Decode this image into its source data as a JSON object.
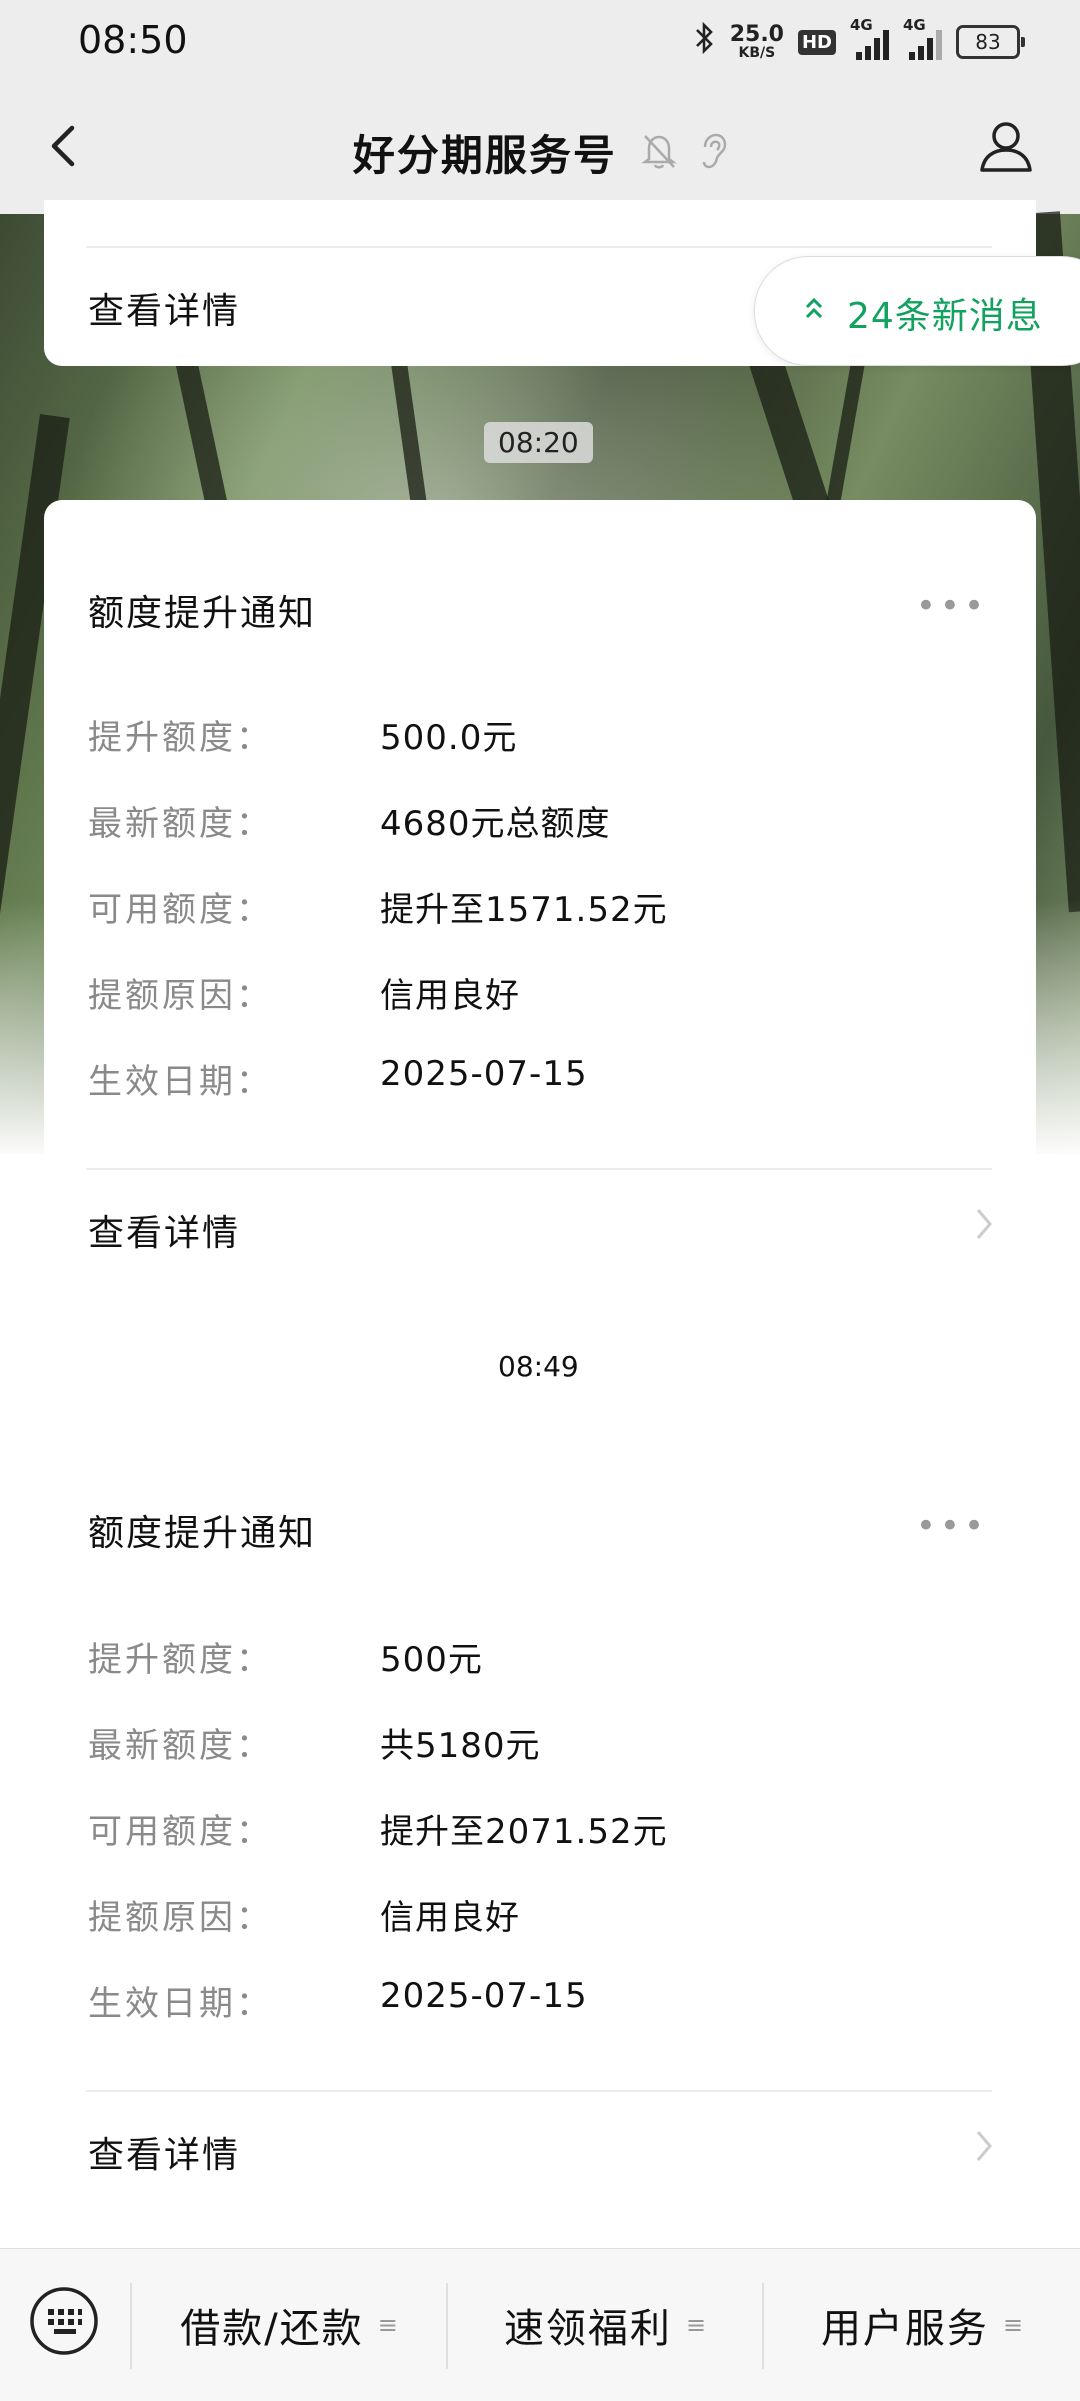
{
  "status_bar": {
    "time": "08:50",
    "net_speed_value": "25.0",
    "net_speed_unit": "KB/S",
    "hd_label": "HD",
    "signal_1": "4G",
    "signal_2": "4G",
    "battery": "83"
  },
  "header": {
    "title": "好分期服务号"
  },
  "top_card": {
    "detail_label": "查看详情"
  },
  "new_messages": {
    "label": "24条新消息"
  },
  "messages": [
    {
      "timestamp": "08:20",
      "title": "额度提升通知",
      "more": "•••",
      "rows": [
        {
          "key": "提升额度：",
          "value": "500.0元"
        },
        {
          "key": "最新额度：",
          "value": "4680元总额度"
        },
        {
          "key": "可用额度：",
          "value": "提升至1571.52元"
        },
        {
          "key": "提额原因：",
          "value": "信用良好"
        },
        {
          "key": "生效日期：",
          "value": "2025-07-15"
        }
      ],
      "detail_label": "查看详情"
    },
    {
      "timestamp": "08:49",
      "title": "额度提升通知",
      "more": "•••",
      "rows": [
        {
          "key": "提升额度：",
          "value": "500元"
        },
        {
          "key": "最新额度：",
          "value": "共5180元"
        },
        {
          "key": "可用额度：",
          "value": "提升至2071.52元"
        },
        {
          "key": "提额原因：",
          "value": "信用良好"
        },
        {
          "key": "生效日期：",
          "value": "2025-07-15"
        }
      ],
      "detail_label": "查看详情"
    }
  ],
  "bottom_menu": {
    "items": [
      {
        "label": "借款/还款"
      },
      {
        "label": "速领福利"
      },
      {
        "label": "用户服务"
      }
    ],
    "hamburger": "≡"
  },
  "colors": {
    "accent_green": "#12a25f",
    "chrome_bg": "#ededed"
  }
}
